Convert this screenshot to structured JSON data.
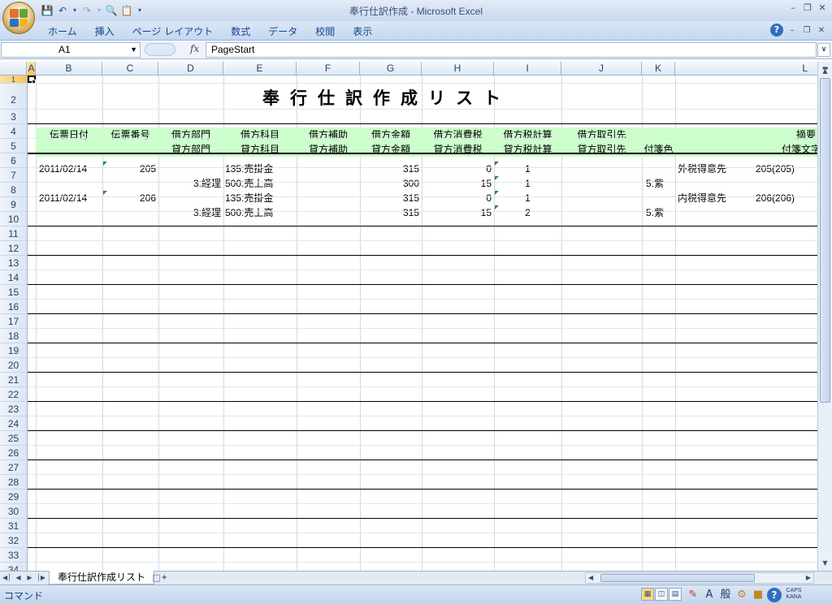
{
  "window": {
    "title": "奉行仕訳作成 - Microsoft Excel"
  },
  "ribbon": {
    "tabs": [
      "ホーム",
      "挿入",
      "ページ レイアウト",
      "数式",
      "データ",
      "校閲",
      "表示"
    ]
  },
  "formula_bar": {
    "name_box": "A1",
    "fx": "fx",
    "formula": "PageStart"
  },
  "columns": [
    "A",
    "B",
    "C",
    "D",
    "E",
    "F",
    "G",
    "H",
    "I",
    "J",
    "K",
    "L"
  ],
  "rows": [
    "1",
    "2",
    "3",
    "4",
    "5",
    "6",
    "7",
    "8",
    "9",
    "10",
    "11",
    "12",
    "13",
    "14",
    "15",
    "16",
    "17",
    "18",
    "19",
    "20",
    "21",
    "22",
    "23",
    "24",
    "25",
    "26",
    "27",
    "28",
    "29",
    "30",
    "31",
    "32",
    "33",
    "34"
  ],
  "sheet": {
    "title": "奉行仕訳作成リスト",
    "header_row1": [
      "伝票日付",
      "伝票番号",
      "借方部門",
      "借方科目",
      "借方補助",
      "借方金額",
      "借方消費税",
      "借方税計算",
      "借方取引先",
      "",
      "摘要"
    ],
    "header_row2": [
      "",
      "",
      "貸方部門",
      "貸方科目",
      "貸方補助",
      "貸方金額",
      "貸方消費税",
      "貸方税計算",
      "貸方取引先",
      "付箋色",
      "付箋文字"
    ],
    "records": [
      {
        "debit": {
          "date": "2011/02/14",
          "no": "205",
          "dept": "",
          "account": "135:売掛金",
          "sub": "",
          "amount": "315",
          "tax": "0",
          "taxcalc": "1",
          "partner": "",
          "tag_color": "",
          "memo": "外税得意先",
          "note": "205(205)"
        },
        "credit": {
          "date": "",
          "no": "",
          "dept": "3:経理",
          "account": "500:売上高",
          "sub": "",
          "amount": "300",
          "tax": "15",
          "taxcalc": "1",
          "partner": "",
          "tag_color": "5:紫",
          "memo": "",
          "note": ""
        }
      },
      {
        "debit": {
          "date": "2011/02/14",
          "no": "206",
          "dept": "",
          "account": "135:売掛金",
          "sub": "",
          "amount": "315",
          "tax": "0",
          "taxcalc": "1",
          "partner": "",
          "tag_color": "",
          "memo": "内税得意先",
          "note": "206(206)"
        },
        "credit": {
          "date": "",
          "no": "",
          "dept": "3:経理",
          "account": "500:売上高",
          "sub": "",
          "amount": "315",
          "tax": "15",
          "taxcalc": "2",
          "partner": "",
          "tag_color": "5:紫",
          "memo": "",
          "note": ""
        }
      }
    ]
  },
  "sheet_tabs": {
    "active": "奉行仕訳作成リスト"
  },
  "status": {
    "mode": "コマンド",
    "caps": "CAPS",
    "kana": "KANA"
  },
  "icons": {
    "office": "office-logo-icon",
    "save": "save-icon",
    "undo": "undo-icon",
    "redo": "redo-icon",
    "print_preview": "print-preview-icon",
    "help": "help-icon"
  },
  "colors": {
    "header_band": "#ccffcc",
    "ribbon": "#c5d8ef",
    "selection": "#f6c45b"
  }
}
